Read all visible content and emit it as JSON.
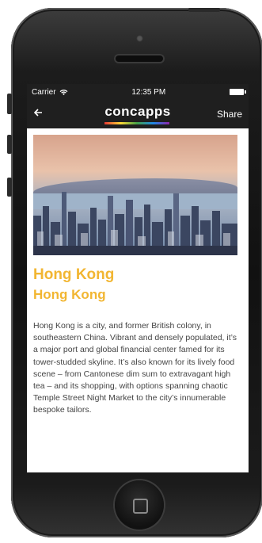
{
  "status_bar": {
    "carrier": "Carrier",
    "time": "12:35 PM"
  },
  "nav": {
    "back_icon": "arrow-left-icon",
    "logo": "concapps",
    "share_label": "Share"
  },
  "article": {
    "title": "Hong Kong",
    "subtitle": "Hong Kong",
    "body": "Hong Kong is a city, and former British colony, in southeastern China. Vibrant and densely populated, it’s a major port and global financial center famed for its tower-studded skyline. It’s also known for its lively food scene – from Cantonese dim sum to extravagant high tea – and its shopping, with options spanning chaotic Temple Street Night Market to the city’s innumerable bespoke tailors."
  },
  "colors": {
    "accent": "#f2b632",
    "bar": "#1f1f1f"
  }
}
